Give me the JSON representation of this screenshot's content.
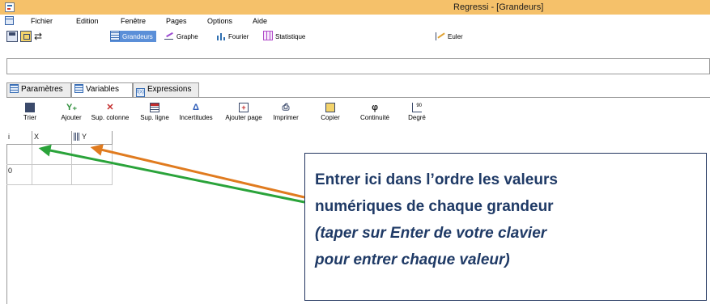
{
  "window": {
    "title": "Regressi - [Grandeurs]"
  },
  "menubar": {
    "items": [
      "Fichier",
      "Edition",
      "Fenêtre",
      "Pages",
      "Options",
      "Aide"
    ]
  },
  "toolbar": {
    "views": [
      {
        "label": "Grandeurs",
        "icon": "grid-icon",
        "active": true
      },
      {
        "label": "Graphe",
        "icon": "graph-icon"
      },
      {
        "label": "Fourier",
        "icon": "fourier-icon"
      },
      {
        "label": "Statistique",
        "icon": "statistics-icon"
      },
      {
        "label": "Euler",
        "icon": "euler-icon"
      }
    ],
    "active_color": "#5b8fd8"
  },
  "entry_bar": {
    "value": ""
  },
  "tabs": [
    {
      "label": "Paramètres",
      "icon": "table-icon"
    },
    {
      "label": "Variables",
      "icon": "table-icon",
      "active": true
    },
    {
      "label": "Expressions",
      "icon": "formula-icon"
    }
  ],
  "tools": [
    {
      "label": "Trier",
      "icon": "sort-icon"
    },
    {
      "label": "Ajouter",
      "icon": "add-variable-icon"
    },
    {
      "label": "Sup. colonne",
      "icon": "delete-column-icon"
    },
    {
      "label": "Sup. ligne",
      "icon": "delete-row-icon"
    },
    {
      "label": "Incertitudes",
      "icon": "delta-icon",
      "glyph": "Δ"
    },
    {
      "label": "Ajouter page",
      "icon": "add-page-icon",
      "glyph": "+"
    },
    {
      "label": "Imprimer",
      "icon": "printer-icon"
    },
    {
      "label": "Copier",
      "icon": "copy-icon"
    },
    {
      "label": "Continuité",
      "icon": "phi-icon",
      "glyph": "φ"
    },
    {
      "label": "Degré",
      "icon": "degree-icon",
      "glyph": "90"
    }
  ],
  "grid": {
    "headers": [
      "i",
      "X",
      "Y"
    ],
    "row_index": "0"
  },
  "callout": {
    "line1": "Entrer ici dans l’ordre les valeurs",
    "line2": "numériques de chaque grandeur",
    "line3": "(taper sur Enter de votre clavier",
    "line4": "pour entrer chaque valeur)",
    "text_color": "#1f3a66"
  },
  "annotation_colors": {
    "arrow_x": "#2aa33a",
    "arrow_y": "#e07b1f"
  }
}
